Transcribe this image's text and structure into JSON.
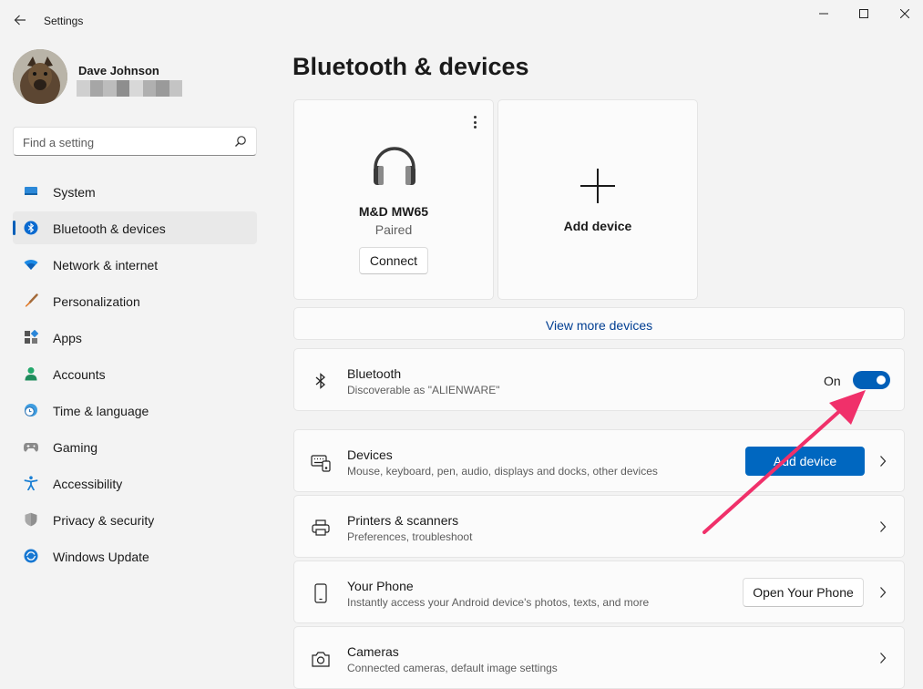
{
  "app": {
    "title": "Settings"
  },
  "user": {
    "name": "Dave Johnson",
    "email_redaction_colors": [
      "#cfcfcf",
      "#a6a6a6",
      "#bcbcbc",
      "#8e8e8e",
      "#d8d8d8",
      "#b0b0b0",
      "#9a9a9a",
      "#c4c4c4"
    ]
  },
  "search": {
    "placeholder": "Find a setting"
  },
  "sidebar": {
    "items": [
      {
        "label": "System",
        "icon": "monitor-icon"
      },
      {
        "label": "Bluetooth & devices",
        "icon": "bluetooth-icon",
        "active": true
      },
      {
        "label": "Network & internet",
        "icon": "wifi-icon"
      },
      {
        "label": "Personalization",
        "icon": "brush-icon"
      },
      {
        "label": "Apps",
        "icon": "apps-icon"
      },
      {
        "label": "Accounts",
        "icon": "person-icon"
      },
      {
        "label": "Time & language",
        "icon": "globe-clock-icon"
      },
      {
        "label": "Gaming",
        "icon": "gamepad-icon"
      },
      {
        "label": "Accessibility",
        "icon": "accessibility-icon"
      },
      {
        "label": "Privacy & security",
        "icon": "shield-icon"
      },
      {
        "label": "Windows Update",
        "icon": "update-icon"
      }
    ]
  },
  "main": {
    "title": "Bluetooth & devices",
    "device_card": {
      "name": "M&D MW65",
      "status": "Paired",
      "connect_label": "Connect",
      "icon": "headphones-icon"
    },
    "add_card": {
      "label": "Add device",
      "icon": "plus-icon"
    },
    "view_more": "View more devices",
    "bluetooth": {
      "title": "Bluetooth",
      "subtitle": "Discoverable as \"ALIENWARE\"",
      "state_label": "On",
      "on": true
    },
    "rows": [
      {
        "title": "Devices",
        "subtitle": "Mouse, keyboard, pen, audio, displays and docks, other devices",
        "button": "Add device",
        "icon": "keyboard-icon"
      },
      {
        "title": "Printers & scanners",
        "subtitle": "Preferences, troubleshoot",
        "icon": "printer-icon"
      },
      {
        "title": "Your Phone",
        "subtitle": "Instantly access your Android device's photos, texts, and more",
        "button": "Open Your Phone",
        "icon": "phone-icon"
      },
      {
        "title": "Cameras",
        "subtitle": "Connected cameras, default image settings",
        "icon": "camera-icon"
      }
    ]
  },
  "colors": {
    "accent": "#005fb8",
    "button": "#0067c0",
    "annotation_arrow": "#f0306a"
  }
}
